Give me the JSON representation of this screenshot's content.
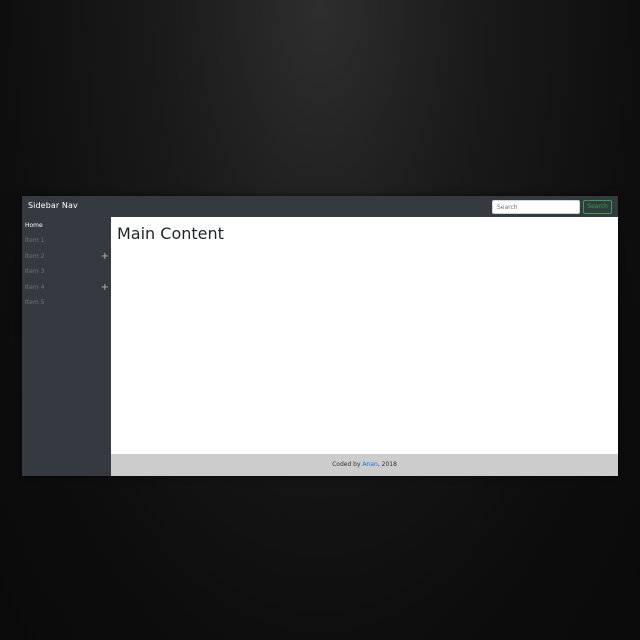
{
  "navbar": {
    "brand": "Sidebar Nav",
    "search_placeholder": "Search",
    "search_button": "Search"
  },
  "sidebar": {
    "items": [
      {
        "label": "Home",
        "active": true,
        "expandable": false
      },
      {
        "label": "Item 1",
        "active": false,
        "expandable": false
      },
      {
        "label": "Item 2",
        "active": false,
        "expandable": true
      },
      {
        "label": "Item 3",
        "active": false,
        "expandable": false
      },
      {
        "label": "Item 4",
        "active": false,
        "expandable": true
      },
      {
        "label": "Item 5",
        "active": false,
        "expandable": false
      }
    ],
    "expand_glyph": "+"
  },
  "main": {
    "title": "Main Content"
  },
  "footer": {
    "prefix": "Coded by ",
    "author": "Anan",
    "suffix": ", 2018"
  },
  "colors": {
    "navbar_bg": "#343a40",
    "search_button": "#28a745",
    "link": "#007bff",
    "footer_bg": "#cccccc"
  }
}
